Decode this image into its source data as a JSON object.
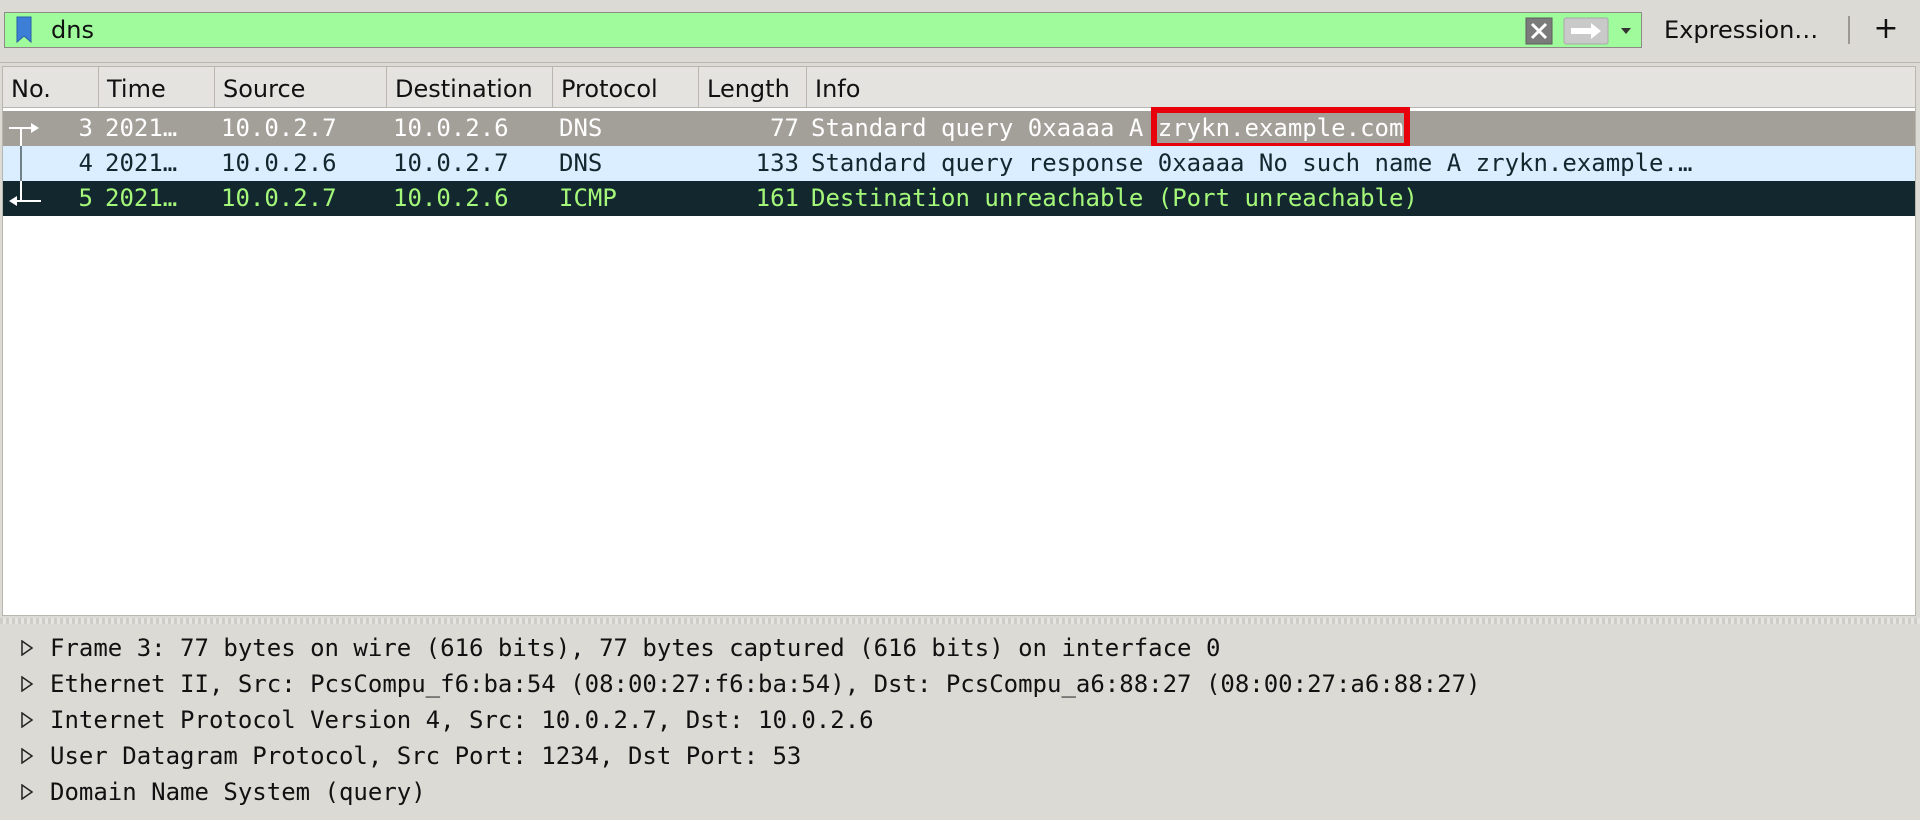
{
  "filter": {
    "value": "dns",
    "expression_label": "Expression…",
    "add_label": "+"
  },
  "columns": [
    "No.",
    "Time",
    "Source",
    "Destination",
    "Protocol",
    "Length",
    "Info"
  ],
  "packets": [
    {
      "no": "3",
      "time": "2021…",
      "source": "10.0.2.7",
      "destination": "10.0.2.6",
      "protocol": "DNS",
      "length": "77",
      "info_prefix": "Standard query 0xaaaa A ",
      "info_highlight": "zrykn.example.com"
    },
    {
      "no": "4",
      "time": "2021…",
      "source": "10.0.2.6",
      "destination": "10.0.2.7",
      "protocol": "DNS",
      "length": "133",
      "info": "Standard query response 0xaaaa No such name A zrykn.example.…"
    },
    {
      "no": "5",
      "time": "2021…",
      "source": "10.0.2.7",
      "destination": "10.0.2.6",
      "protocol": "ICMP",
      "length": "161",
      "info": "Destination unreachable (Port unreachable)"
    }
  ],
  "details": [
    "Frame 3: 77 bytes on wire (616 bits), 77 bytes captured (616 bits) on interface 0",
    "Ethernet II, Src: PcsCompu_f6:ba:54 (08:00:27:f6:ba:54), Dst: PcsCompu_a6:88:27 (08:00:27:a6:88:27)",
    "Internet Protocol Version 4, Src: 10.0.2.7, Dst: 10.0.2.6",
    "User Datagram Protocol, Src Port: 1234, Dst Port: 53",
    "Domain Name System (query)"
  ],
  "colors": {
    "filter_valid": "#9ffb9c",
    "row_selected": "#a39f99",
    "row_dns": "#daeeff",
    "row_icmp_error": "#12272e",
    "icmp_text": "#a5f77a",
    "annotation": "#e8000b"
  }
}
